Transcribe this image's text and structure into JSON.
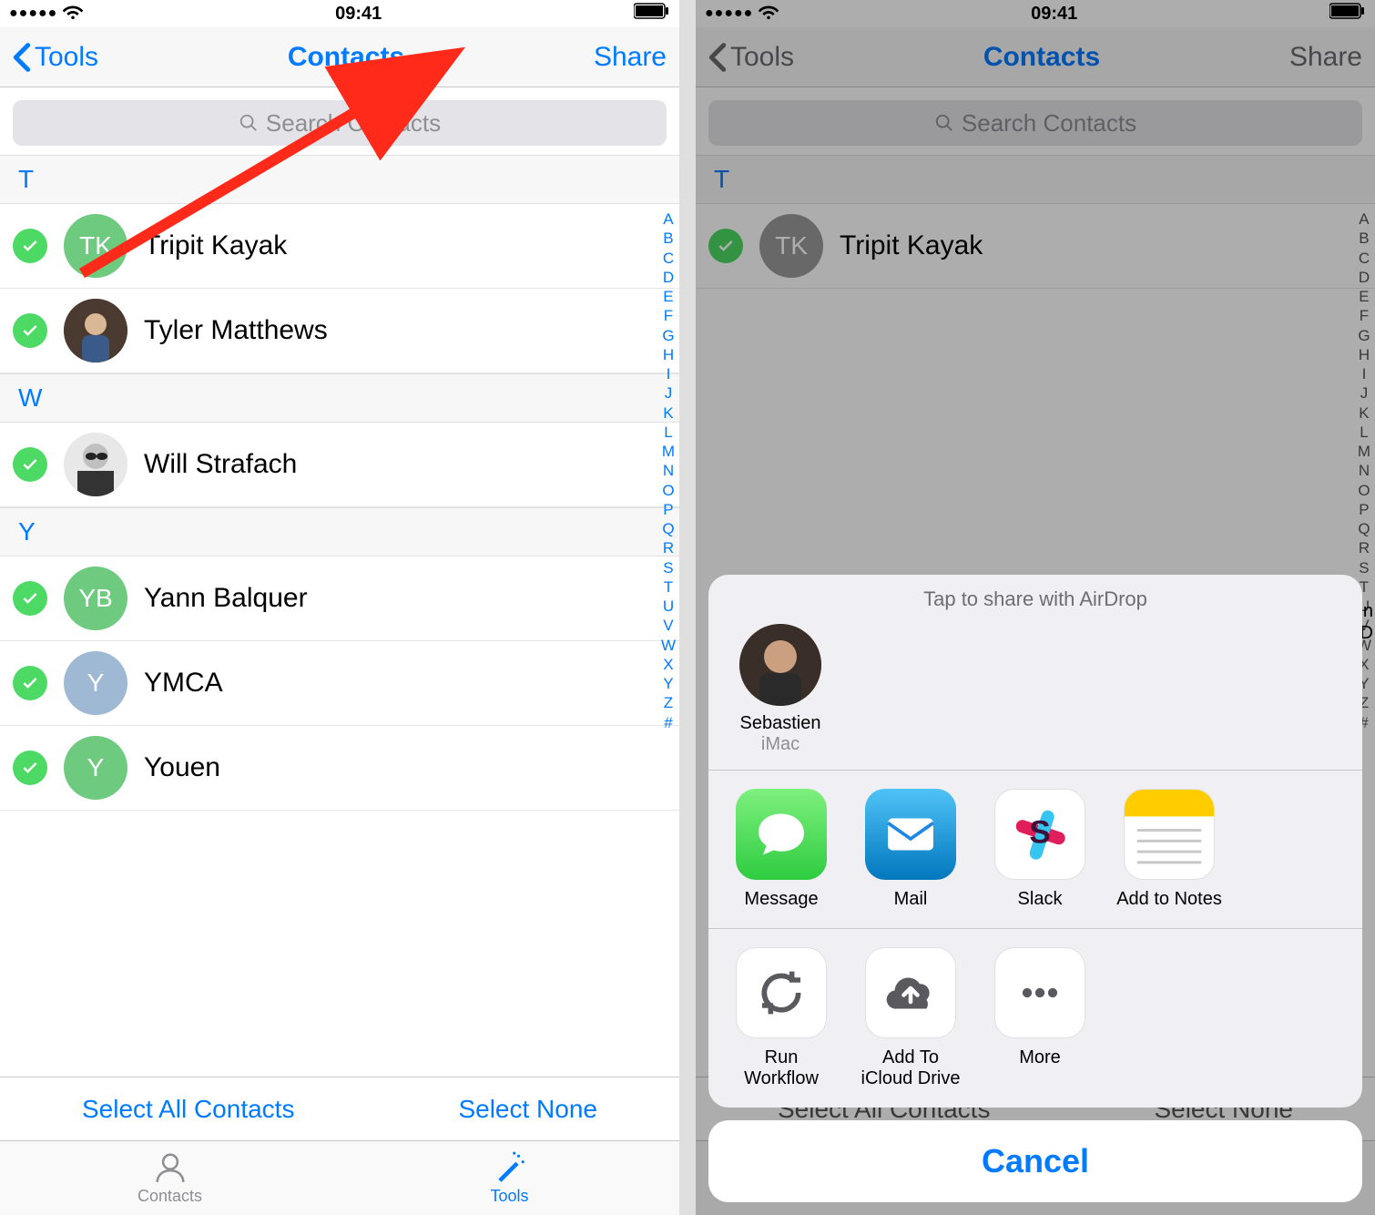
{
  "status": {
    "time": "09:41"
  },
  "nav": {
    "back": "Tools",
    "title": "Contacts",
    "action": "Share"
  },
  "search": {
    "placeholder": "Search Contacts"
  },
  "sections": {
    "t": {
      "header": "T",
      "items": [
        {
          "initials": "TK",
          "name": "Tripit Kayak",
          "avatar": "green"
        },
        {
          "initials": "",
          "name": "Tyler Matthews",
          "avatar": "photo"
        }
      ]
    },
    "w": {
      "header": "W",
      "items": [
        {
          "initials": "",
          "name": "Will Strafach",
          "avatar": "photo"
        }
      ]
    },
    "y": {
      "header": "Y",
      "items": [
        {
          "initials": "YB",
          "name": "Yann Balquer",
          "avatar": "green"
        },
        {
          "initials": "Y",
          "name": "YMCA",
          "avatar": "blue"
        },
        {
          "initials": "Y",
          "name": "Youen",
          "avatar": "green"
        }
      ]
    }
  },
  "index_letters": [
    "A",
    "B",
    "C",
    "D",
    "E",
    "F",
    "G",
    "H",
    "I",
    "J",
    "K",
    "L",
    "M",
    "N",
    "O",
    "P",
    "Q",
    "R",
    "S",
    "T",
    "U",
    "V",
    "W",
    "X",
    "Y",
    "Z",
    "#"
  ],
  "bottom": {
    "select_all": "Select All Contacts",
    "select_none": "Select None"
  },
  "tabs": {
    "contacts": "Contacts",
    "tools": "Tools"
  },
  "sheet": {
    "header": "Tap to share with AirDrop",
    "airdrop": {
      "name": "Sebastien",
      "device": "iMac"
    },
    "apps": [
      {
        "id": "message",
        "label": "Message"
      },
      {
        "id": "mail",
        "label": "Mail"
      },
      {
        "id": "slack",
        "label": "Slack"
      },
      {
        "id": "notes",
        "label": "Add to Notes"
      }
    ],
    "actions": [
      {
        "id": "workflow",
        "label": "Run\nWorkflow"
      },
      {
        "id": "icloud",
        "label": "Add To\niCloud Drive"
      },
      {
        "id": "more",
        "label": "More"
      }
    ],
    "cancel": "Cancel",
    "peek1": "In",
    "peek2": "D"
  }
}
